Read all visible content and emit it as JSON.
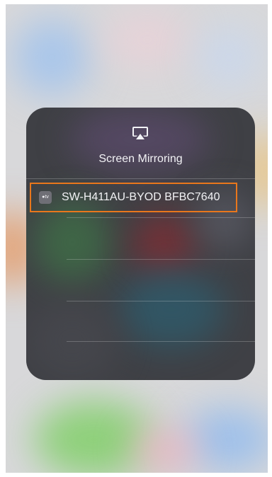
{
  "screen_mirroring": {
    "title": "Screen Mirroring",
    "icon": "airplay-icon",
    "selection_color": "#e9771c",
    "devices": [
      {
        "icon": "apple-tv-icon",
        "badge": "●tv",
        "name": "SW-H411AU-BYOD BFBC7640",
        "highlighted": true
      }
    ]
  }
}
